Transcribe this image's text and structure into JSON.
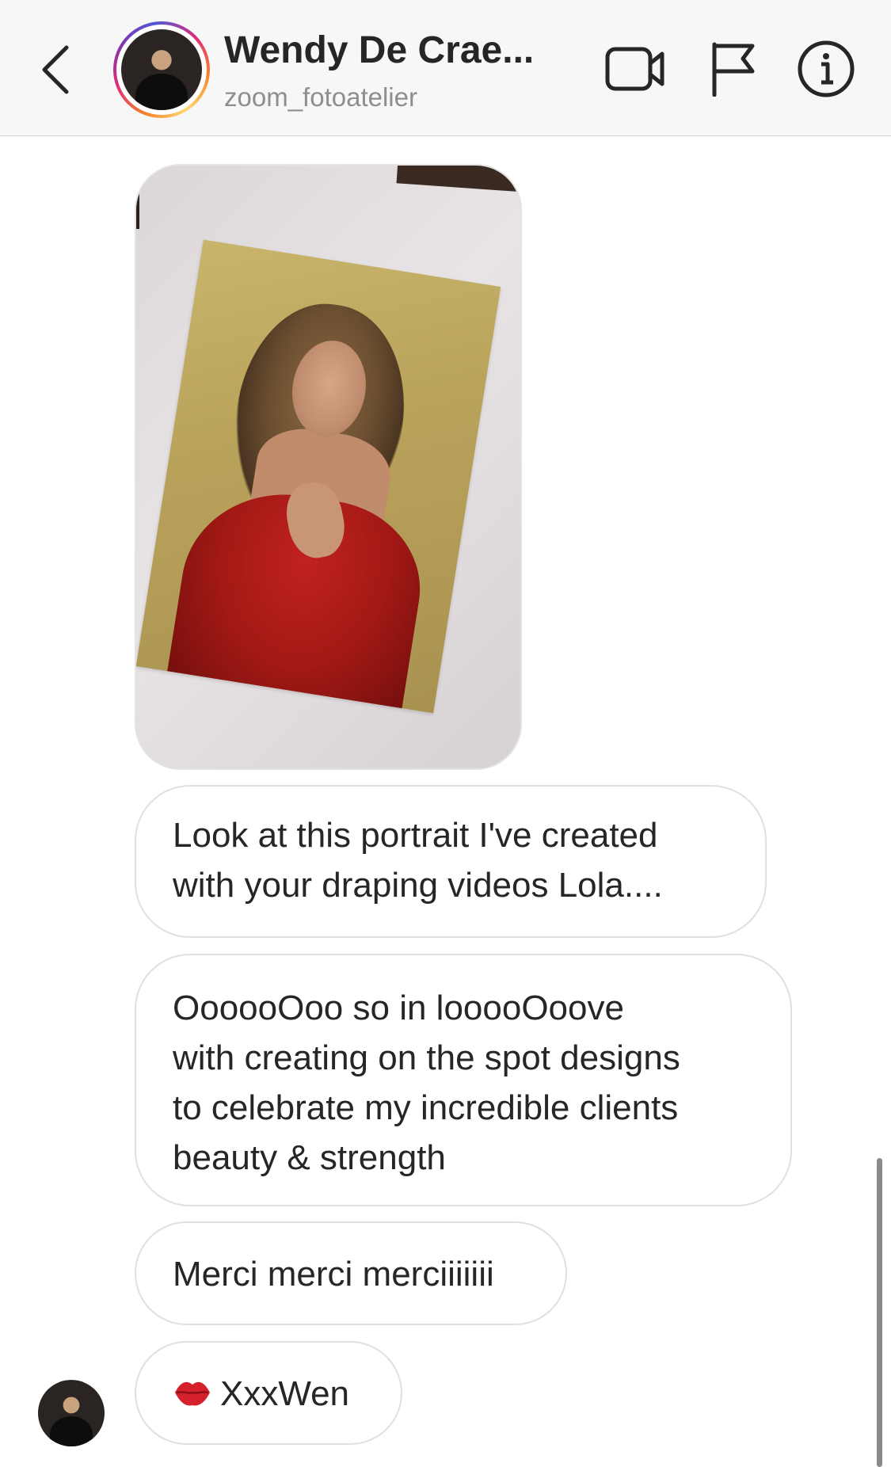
{
  "header": {
    "name": "Wendy De Crae...",
    "username": "zoom_fotoatelier",
    "icons": [
      "back-chevron-icon",
      "video-call-icon",
      "flag-icon",
      "info-icon"
    ]
  },
  "messages": [
    {
      "type": "image",
      "description_icon": "portrait-photo"
    },
    {
      "type": "text",
      "lines": [
        "Look at this portrait I've created",
        "with your draping videos Lola...."
      ]
    },
    {
      "type": "text",
      "lines": [
        "OooooOoo so in looooOoove",
        "with creating on the spot designs",
        "to celebrate my incredible clients",
        "beauty & strength"
      ]
    },
    {
      "type": "text",
      "lines": [
        "Merci merci merciiiiiii"
      ]
    },
    {
      "type": "text",
      "emoji": "lips-kiss-icon",
      "text": "XxxWen"
    }
  ],
  "colors": {
    "header_bg": "#f7f7f7",
    "text": "#262626",
    "secondary_text": "#8e8e8e",
    "bubble_border": "#e0e0e0"
  }
}
